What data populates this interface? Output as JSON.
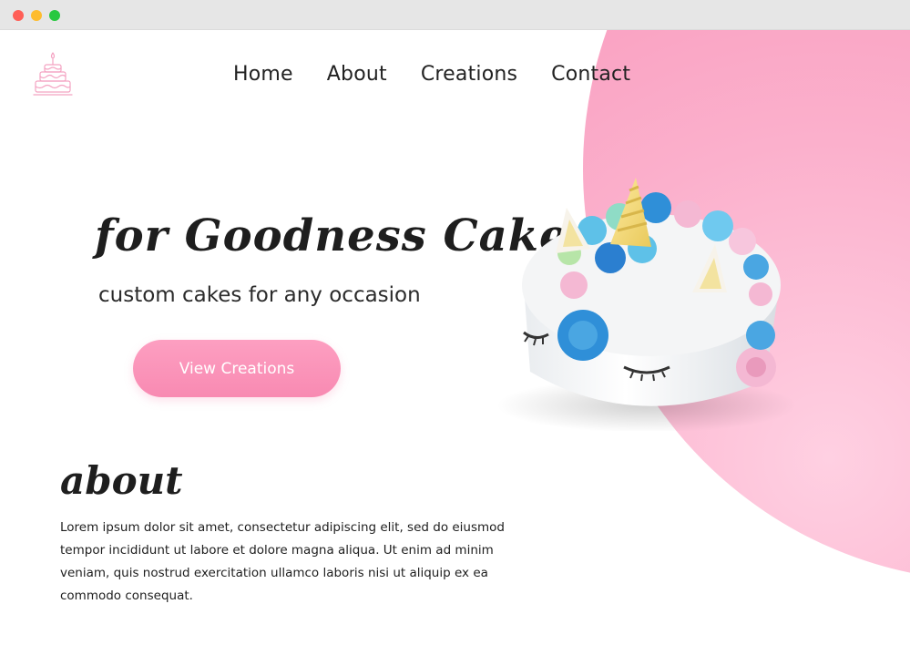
{
  "nav": {
    "items": [
      {
        "label": "Home"
      },
      {
        "label": "About"
      },
      {
        "label": "Creations"
      },
      {
        "label": "Contact"
      }
    ]
  },
  "hero": {
    "title": "for Goodness Cakes",
    "subtitle": "custom cakes for any occasion",
    "cta_label": "View Creations"
  },
  "about": {
    "heading": "about",
    "body": "Lorem ipsum dolor sit amet, consectetur adipiscing elit, sed do eiusmod tempor incididunt ut labore et dolore magna aliqua. Ut enim ad minim veniam, quis nostrud exercitation ullamco laboris nisi ut aliquip ex ea commodo consequat."
  },
  "icons": {
    "logo": "cake-icon"
  },
  "colors": {
    "accent": "#f88ab2",
    "blob": "#f998bb",
    "text": "#1e1e1e"
  }
}
